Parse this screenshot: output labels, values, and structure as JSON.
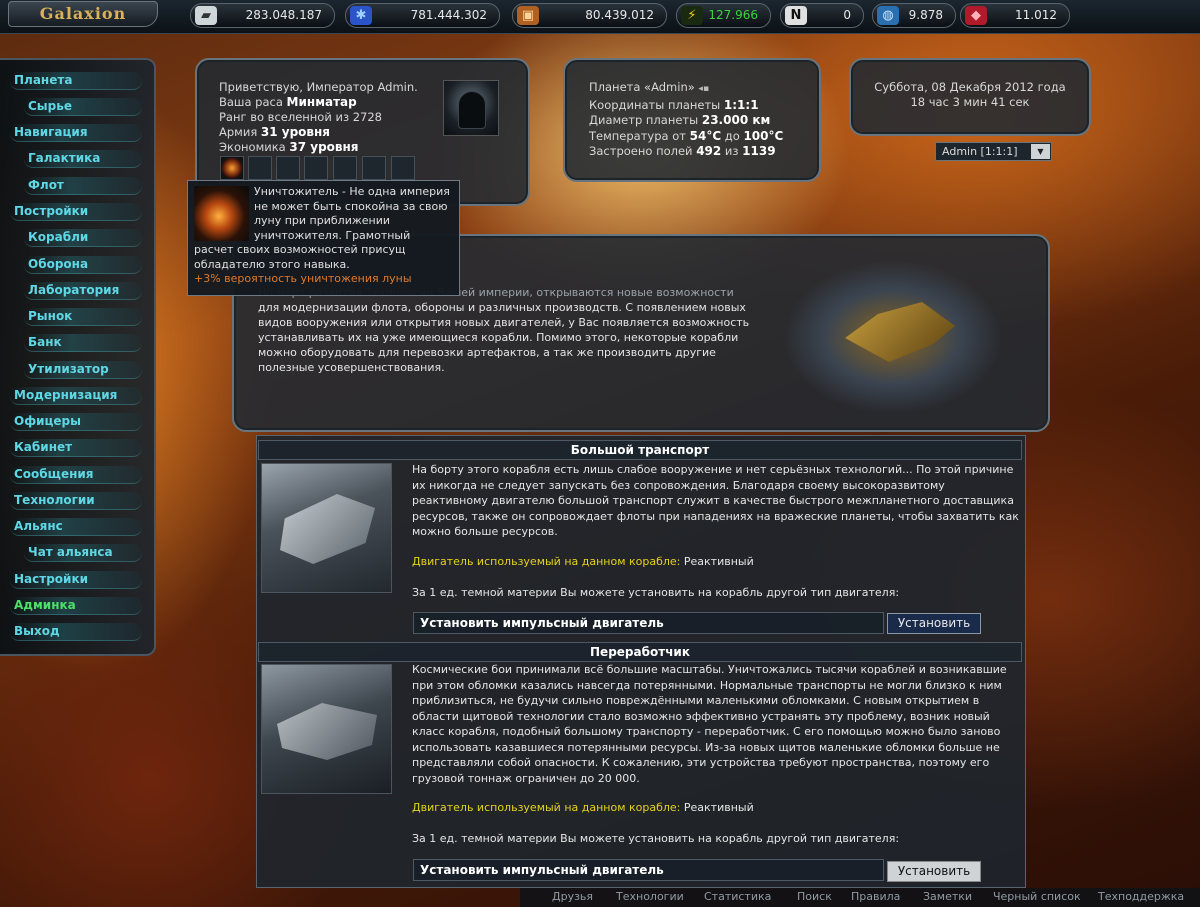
{
  "logo": "Galaxion",
  "resources": [
    {
      "icon": "metal-icon",
      "value": "283.048.187",
      "color": "#e8e8e8",
      "ic_bg": "#cfd6da"
    },
    {
      "icon": "crystal-icon",
      "value": "781.444.302",
      "color": "#e8e8e8",
      "ic_bg": "#2a54c8"
    },
    {
      "icon": "deuterium-icon",
      "value": "80.439.012",
      "color": "#e8e8e8",
      "ic_bg": "#b06020"
    },
    {
      "icon": "energy-icon",
      "value": "127.966",
      "color": "#3ad43a",
      "ic_bg": "#1a2a10"
    },
    {
      "icon": "dark-matter-icon",
      "value": "0",
      "color": "#e8e8e8",
      "ic_bg": "#e0e0e0"
    },
    {
      "icon": "globe-icon",
      "value": "9.878",
      "color": "#e8e8e8",
      "ic_bg": "#2a6fb0"
    },
    {
      "icon": "gem-icon",
      "value": "11.012",
      "color": "#e8e8e8",
      "ic_bg": "#b01a2a"
    }
  ],
  "nav": [
    {
      "label": "Планета",
      "green": false
    },
    {
      "label": "Сырье",
      "green": false
    },
    {
      "label": "Навигация",
      "green": false
    },
    {
      "label": "Галактика",
      "green": false
    },
    {
      "label": "Флот",
      "green": false
    },
    {
      "label": "Постройки",
      "green": false
    },
    {
      "label": "Корабли",
      "green": false
    },
    {
      "label": "Оборона",
      "green": false
    },
    {
      "label": "Лаборатория",
      "green": false
    },
    {
      "label": "Рынок",
      "green": false
    },
    {
      "label": "Банк",
      "green": false
    },
    {
      "label": "Утилизатор",
      "green": false
    },
    {
      "label": "Модернизация",
      "green": false
    },
    {
      "label": "Офицеры",
      "green": false
    },
    {
      "label": "Кабинет",
      "green": false
    },
    {
      "label": "Сообщения",
      "green": false
    },
    {
      "label": "Технологии",
      "green": false
    },
    {
      "label": "Альянс",
      "green": false
    },
    {
      "label": "Чат альянса",
      "green": false
    },
    {
      "label": "Настройки",
      "green": false
    },
    {
      "label": "Админка",
      "green": true
    },
    {
      "label": "Выход",
      "green": false
    }
  ],
  "player": {
    "greeting": "Приветствую, Император Admin.",
    "race_label": "Ваша раса ",
    "race": "Минматар",
    "rank": "Ранг во вселенной из 2728",
    "army_label": "Армия ",
    "army": "31 уровня",
    "economy_label": "Экономика ",
    "economy": "37 уровня"
  },
  "planet": {
    "name": "Планета «Admin»",
    "coords_label": "Координаты планеты ",
    "coords": "1:1:1",
    "diameter_label": "Диаметр планеты ",
    "diameter": "23.000 км",
    "temp_label": "Температура от ",
    "temp_from": "54°C",
    "temp_mid": " до ",
    "temp_to": "100°C",
    "fields_label": "Застроено полей ",
    "fields_used": "492",
    "fields_mid": " из ",
    "fields_total": "1139"
  },
  "clock": {
    "date": "Суббота, 08 Декабря 2012 года",
    "time": "18 час 3 мин 41 сек"
  },
  "planet_select": "Admin [1:1:1]",
  "tooltip": {
    "text": "Уничтожитель - Не одна империя не может быть спокойна за свою луну при приближении уничтожителя. Грамотный расчет своих возможностей присущ обладателю этого навыка.",
    "bonus": "+3% вероятность уничтожения луны"
  },
  "info": {
    "partial": "Но мера развития Технологий Вашей империи, открываются новые возможности",
    "text": "для модернизации флота, обороны и различных производств. С появлением новых видов вооружения или открытия новых двигателей, у Вас появляется возможность устанавливать их на уже имеющиеся корабли. Помимо этого, некоторые корабли можно оборудовать для перевозки артефактов, а так же производить другие полезные усовершенствования."
  },
  "ships": [
    {
      "title": "Большой транспорт",
      "desc": "На борту этого корабля есть лишь слабое вооружение и нет серьёзных технологий... По этой причине их никогда не следует запускать без сопровождения. Благодаря своему высокоразвитому реактивному двигателю большой транспорт служит в качестве быстрого межпланетного доставщика ресурсов, также он сопровождает флоты при нападениях на вражеские планеты, чтобы захватить как можно больше ресурсов.",
      "engine_label": "Двигатель используемый на данном корабле:",
      "engine": " Реактивный",
      "cost": "За 1 ед. темной материи Вы можете установить на корабль другой тип двигателя:",
      "install_label": "Установить импульсный двигатель",
      "install_btn": "Установить"
    },
    {
      "title": "Переработчик",
      "desc": "Космические бои принимали всё большие масштабы. Уничтожались тысячи кораблей и возникавшие при этом обломки казались навсегда потерянными. Нормальные транспорты не могли близко к ним приблизиться, не будучи сильно повреждёнными маленькими обломками. С новым открытием в области щитовой технологии стало возможно эффективно устранять эту проблему, возник новый класс корабля, подобный большому транспорту - переработчик. С его помощью можно было заново использовать казавшиеся потерянными ресурсы. Из-за новых щитов маленькие обломки больше не представляли собой опасности. К сожалению, эти устройства требуют пространства, поэтому его грузовой тоннаж ограничен до 20 000.",
      "engine_label": "Двигатель используемый на данном корабле:",
      "engine": " Реактивный",
      "cost": "За 1 ед. темной материи Вы можете установить на корабль другой тип двигателя:",
      "install_label": "Установить импульсный двигатель",
      "install_btn": "Установить"
    }
  ],
  "footer": [
    "Друзья",
    "Технологии",
    "Статистика",
    "Поиск",
    "Правила",
    "Заметки",
    "Черный список",
    "Техподдержка"
  ]
}
